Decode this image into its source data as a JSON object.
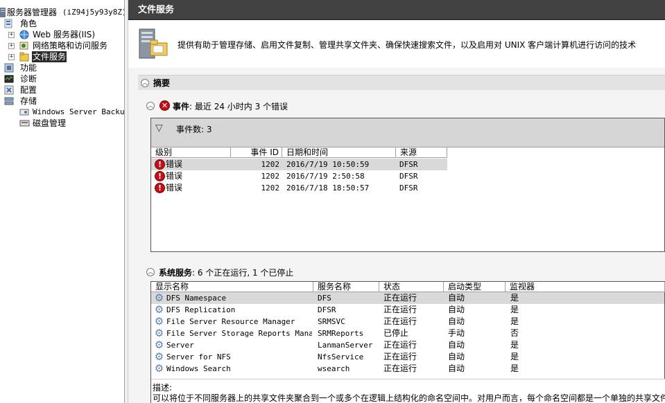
{
  "tree": {
    "root_label": "服务器管理器",
    "root_host": "(iZ94j5y93y8Z)",
    "roles_label": "角色",
    "web_label": "Web 服务器(IIS)",
    "npas_label": "网络策略和访问服务",
    "file_label": "文件服务",
    "features_label": "功能",
    "diag_label": "诊断",
    "config_label": "配置",
    "storage_label": "存储",
    "wsb_label": "Windows Server Backup",
    "disk_label": "磁盘管理"
  },
  "header": {
    "title": "文件服务",
    "description": "提供有助于管理存储、启用文件复制、管理共享文件夹、确保快速搜索文件，以及启用对 UNIX 客户端计算机进行访问的技术"
  },
  "summary": {
    "title": "摘要"
  },
  "events": {
    "title": "事件",
    "text": ": 最近 24 小时内 3 个错误",
    "filter_label": "事件数: 3",
    "columns": [
      "级别",
      "事件 ID",
      "日期和时间",
      "来源"
    ],
    "rows": [
      {
        "level": "错误",
        "id": "1202",
        "datetime": "2016/7/19 10:50:59",
        "source": "DFSR"
      },
      {
        "level": "错误",
        "id": "1202",
        "datetime": "2016/7/19 2:50:58",
        "source": "DFSR"
      },
      {
        "level": "错误",
        "id": "1202",
        "datetime": "2016/7/18 18:50:57",
        "source": "DFSR"
      }
    ]
  },
  "services": {
    "title": "系统服务",
    "text": ": 6 个正在运行, 1 个已停止",
    "columns": [
      "显示名称",
      "服务名称",
      "状态",
      "启动类型",
      "监视器"
    ],
    "rows": [
      {
        "display": "DFS Namespace",
        "service": "DFS",
        "status": "正在运行",
        "startup": "自动",
        "monitor": "是"
      },
      {
        "display": "DFS Replication",
        "service": "DFSR",
        "status": "正在运行",
        "startup": "自动",
        "monitor": "是"
      },
      {
        "display": "File Server Resource Manager",
        "service": "SRMSVC",
        "status": "正在运行",
        "startup": "自动",
        "monitor": "是"
      },
      {
        "display": "File Server Storage Reports Manager",
        "service": "SRMReports",
        "status": "已停止",
        "startup": "手动",
        "monitor": "否"
      },
      {
        "display": "Server",
        "service": "LanmanServer",
        "status": "正在运行",
        "startup": "自动",
        "monitor": "是"
      },
      {
        "display": "Server for NFS",
        "service": "NfsService",
        "status": "正在运行",
        "startup": "自动",
        "monitor": "是"
      },
      {
        "display": "Windows Search",
        "service": "wsearch",
        "status": "正在运行",
        "startup": "自动",
        "monitor": "是"
      }
    ],
    "desc_label": "描述:",
    "desc_text": "可以将位于不同服务器上的共享文件夹聚合到一个或多个在逻辑上结构化的命名空间中。对用户而言，每个命名空间都是一个单独的共享文件"
  },
  "colors": {
    "titlebar": "#424242",
    "error": "#c0111b",
    "selection": "#2b2b2b"
  }
}
